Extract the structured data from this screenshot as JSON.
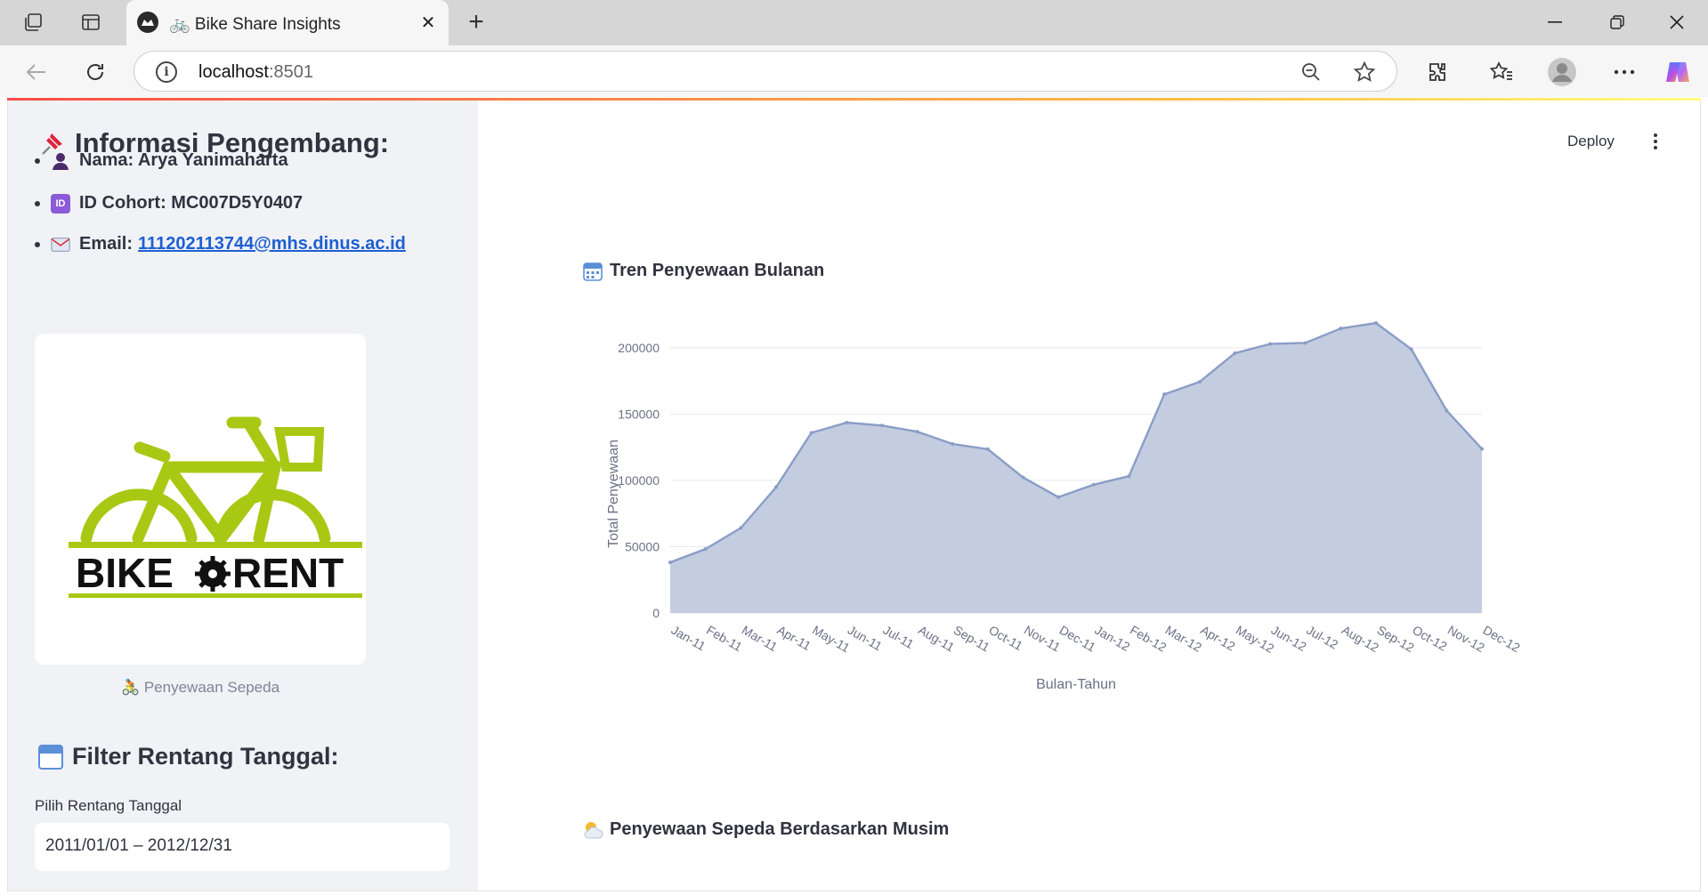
{
  "browser": {
    "tab_title": "🚲 Bike Share Insights",
    "address_host": "localhost",
    "address_port": ":8501",
    "icons": [
      "workspaces-icon",
      "tab-actions-icon",
      "streamlit-favicon",
      "close-icon",
      "plus-icon",
      "minimize-icon",
      "restore-icon",
      "close-window-icon",
      "back-icon",
      "reload-icon",
      "info-icon",
      "zoom-out-icon",
      "star-icon",
      "extensions-icon",
      "favorites-icon",
      "profile-icon",
      "more-icon",
      "copilot-icon"
    ]
  },
  "app": {
    "deploy_label": "Deploy"
  },
  "sidebar": {
    "heading": "Informasi Pengembang:",
    "name_line": "Nama: Arya Yanimaharta",
    "cohort_line": "ID Cohort: MC007D5Y0407",
    "email_prefix": "Email:",
    "email_link": "111202113744@mhs.dinus.ac.id",
    "logo_text_left": "BIKE",
    "logo_text_right": "RENT",
    "logo_caption": "🚴 Penyewaan Sepeda",
    "filter_heading": "Filter Rentang Tanggal:",
    "date_label": "Pilih Rentang Tanggal",
    "date_value": "2011/01/01 – 2012/12/31"
  },
  "main": {
    "chart_title": "Tren Penyewaan Bulanan",
    "season_title": "Penyewaan Sepeda Berdasarkan Musim"
  },
  "chart_data": {
    "type": "area",
    "title": "",
    "xlabel": "Bulan-Tahun",
    "ylabel": "Total Penyewaan",
    "ylim": [
      0,
      220000
    ],
    "yticks": [
      0,
      50000,
      100000,
      150000,
      200000
    ],
    "grid": true,
    "colors": {
      "fill": "#c4cde0",
      "line": "#8a9dc6"
    },
    "categories": [
      "Jan-11",
      "Feb-11",
      "Mar-11",
      "Apr-11",
      "May-11",
      "Jun-11",
      "Jul-11",
      "Aug-11",
      "Sep-11",
      "Oct-11",
      "Nov-11",
      "Dec-11",
      "Jan-12",
      "Feb-12",
      "Mar-12",
      "Apr-12",
      "May-12",
      "Jun-12",
      "Jul-12",
      "Aug-12",
      "Sep-12",
      "Oct-12",
      "Nov-12",
      "Dec-12"
    ],
    "values": [
      38189,
      48215,
      64045,
      94870,
      135821,
      143512,
      141341,
      136691,
      127418,
      123511,
      102167,
      87323,
      96744,
      103137,
      164875,
      174224,
      195865,
      202830,
      203607,
      214503,
      218573,
      198841,
      152664,
      123713
    ]
  }
}
